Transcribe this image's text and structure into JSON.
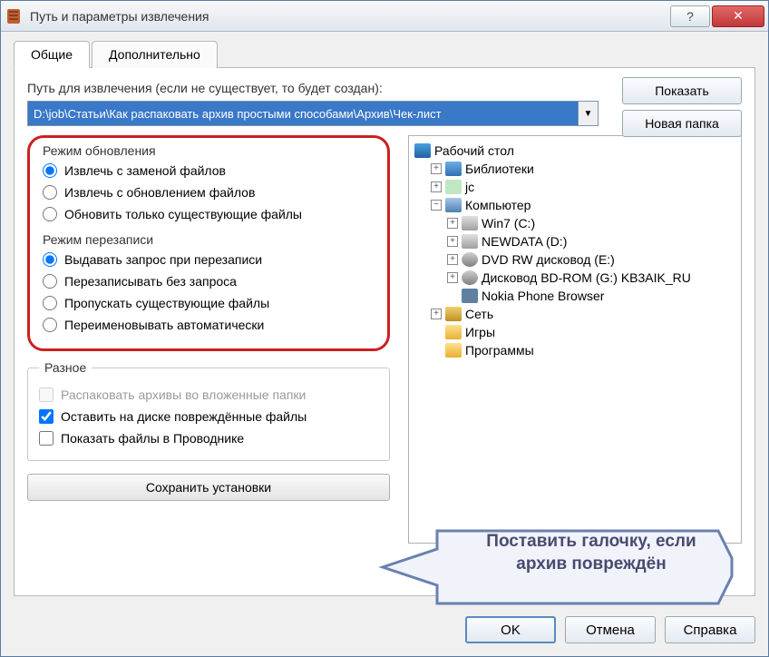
{
  "titlebar": {
    "title": "Путь и параметры извлечения"
  },
  "tabs": {
    "general": "Общие",
    "advanced": "Дополнительно"
  },
  "path": {
    "label": "Путь для извлечения (если не существует, то будет создан):",
    "value": "D:\\job\\Статьи\\Как распаковать архив простыми способами\\Архив\\Чек-лист"
  },
  "side": {
    "show": "Показать",
    "newfolder": "Новая папка"
  },
  "update_mode": {
    "legend": "Режим обновления",
    "opt1": "Извлечь с заменой файлов",
    "opt2": "Извлечь с обновлением файлов",
    "opt3": "Обновить только существующие файлы"
  },
  "overwrite_mode": {
    "legend": "Режим перезаписи",
    "opt1": "Выдавать запрос при перезаписи",
    "opt2": "Перезаписывать без запроса",
    "opt3": "Пропускать существующие файлы",
    "opt4": "Переименовывать автоматически"
  },
  "misc": {
    "legend": "Разное",
    "opt1": "Распаковать архивы во вложенные папки",
    "opt2": "Оставить на диске повреждённые файлы",
    "opt3": "Показать файлы в Проводнике"
  },
  "save_settings": "Сохранить установки",
  "tree": {
    "desktop": "Рабочий стол",
    "libraries": "Библиотеки",
    "user": "jc",
    "computer": "Компьютер",
    "win7": "Win7 (C:)",
    "newdata": "NEWDATA (D:)",
    "dvd": "DVD RW дисковод (E:)",
    "bd": "Дисковод BD-ROM (G:) KB3AIK_RU",
    "phone": "Nokia Phone Browser",
    "network": "Сеть",
    "games": "Игры",
    "programs": "Программы"
  },
  "callout": "Поставить галочку, если архив повреждён",
  "footer": {
    "ok": "OK",
    "cancel": "Отмена",
    "help": "Справка"
  }
}
